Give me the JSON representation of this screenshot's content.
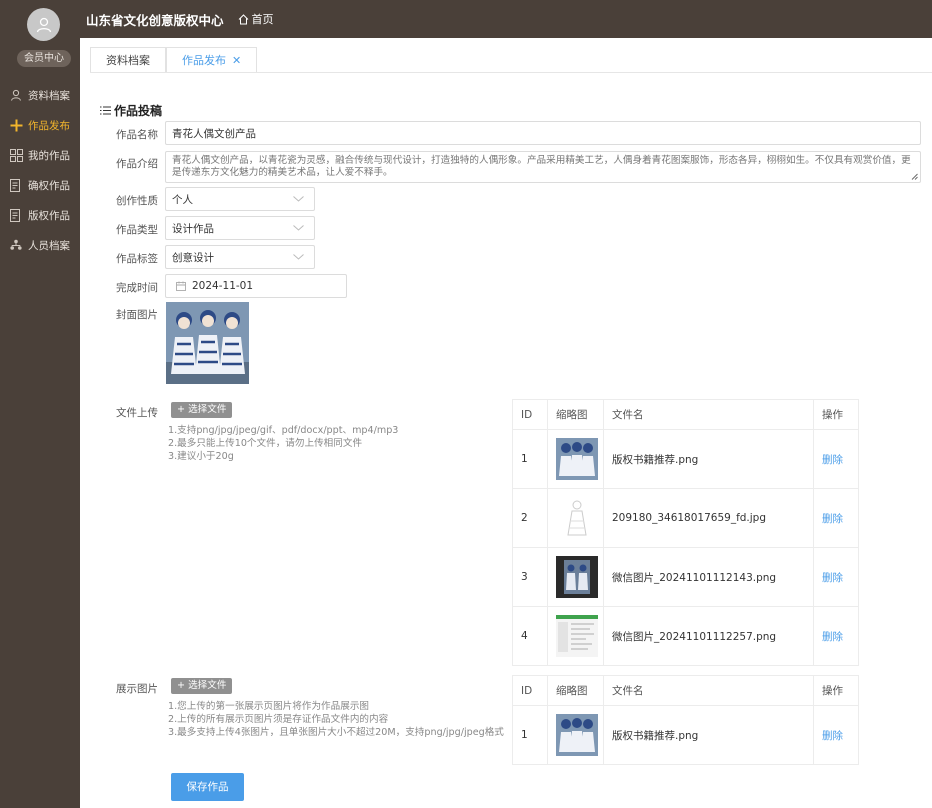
{
  "sidebar": {
    "member_center": "会员中心",
    "items": [
      {
        "label": "资料档案",
        "icon": "user-icon",
        "active": false
      },
      {
        "label": "作品发布",
        "icon": "plus-icon",
        "active": true
      },
      {
        "label": "我的作品",
        "icon": "grid-icon",
        "active": false
      },
      {
        "label": "确权作品",
        "icon": "document-icon",
        "active": false
      },
      {
        "label": "版权作品",
        "icon": "document-icon",
        "active": false
      },
      {
        "label": "人员档案",
        "icon": "org-icon",
        "active": false
      }
    ]
  },
  "header": {
    "brand": "山东省文化创意版权中心",
    "home": "首页"
  },
  "tabs": [
    {
      "label": "资料档案",
      "active": false
    },
    {
      "label": "作品发布",
      "active": true,
      "close": "✕"
    }
  ],
  "form": {
    "title": "作品投稿",
    "name_label": "作品名称",
    "name_value": "青花人偶文创产品",
    "intro_label": "作品介绍",
    "intro_value": "青花人偶文创产品，以青花瓷为灵感，融合传统与现代设计，打造独特的人偶形象。产品采用精美工艺，人偶身着青花图案服饰，形态各异，栩栩如生。不仅具有观赏价值，更是传递东方文化魅力的精美艺术品，让人爱不释手。",
    "nature_label": "创作性质",
    "nature_value": "个人",
    "type_label": "作品类型",
    "type_value": "设计作品",
    "tag_label": "作品标签",
    "tag_value": "创意设计",
    "date_label": "完成时间",
    "date_value": "2024-11-01",
    "cover_label": "封面图片",
    "upload_label": "文件上传",
    "choose_file": "+ 选择文件",
    "upload_hints": [
      "1.支持png/jpg/jpeg/gif、pdf/docx/ppt、mp4/mp3",
      "2.最多只能上传10个文件，请勿上传相同文件",
      "3.建议小于20g"
    ],
    "display_label": "展示图片",
    "display_hints": [
      "1.您上传的第一张展示页图片将作为作品展示图",
      "2.上传的所有展示页图片须是存证作品文件内的内容",
      "3.最多支持上传4张图片，且单张图片大小不超过20M，支持png/jpg/jpeg格式"
    ],
    "save_label": "保存作品"
  },
  "file_table": {
    "headers": [
      "ID",
      "缩略图",
      "文件名",
      "操作"
    ],
    "rows": [
      {
        "id": "1",
        "name": "版权书籍推荐.png",
        "action": "删除"
      },
      {
        "id": "2",
        "name": "209180_34618017659_fd.jpg",
        "action": "删除"
      },
      {
        "id": "3",
        "name": "微信图片_20241101112143.png",
        "action": "删除"
      },
      {
        "id": "4",
        "name": "微信图片_20241101112257.png",
        "action": "删除"
      }
    ]
  },
  "display_table": {
    "headers": [
      "ID",
      "缩略图",
      "文件名",
      "操作"
    ],
    "rows": [
      {
        "id": "1",
        "name": "版权书籍推荐.png",
        "action": "删除"
      }
    ]
  },
  "colors": {
    "sidebar_bg": "#4a4039",
    "accent": "#4a9de8",
    "active_nav": "#f2b52c"
  }
}
